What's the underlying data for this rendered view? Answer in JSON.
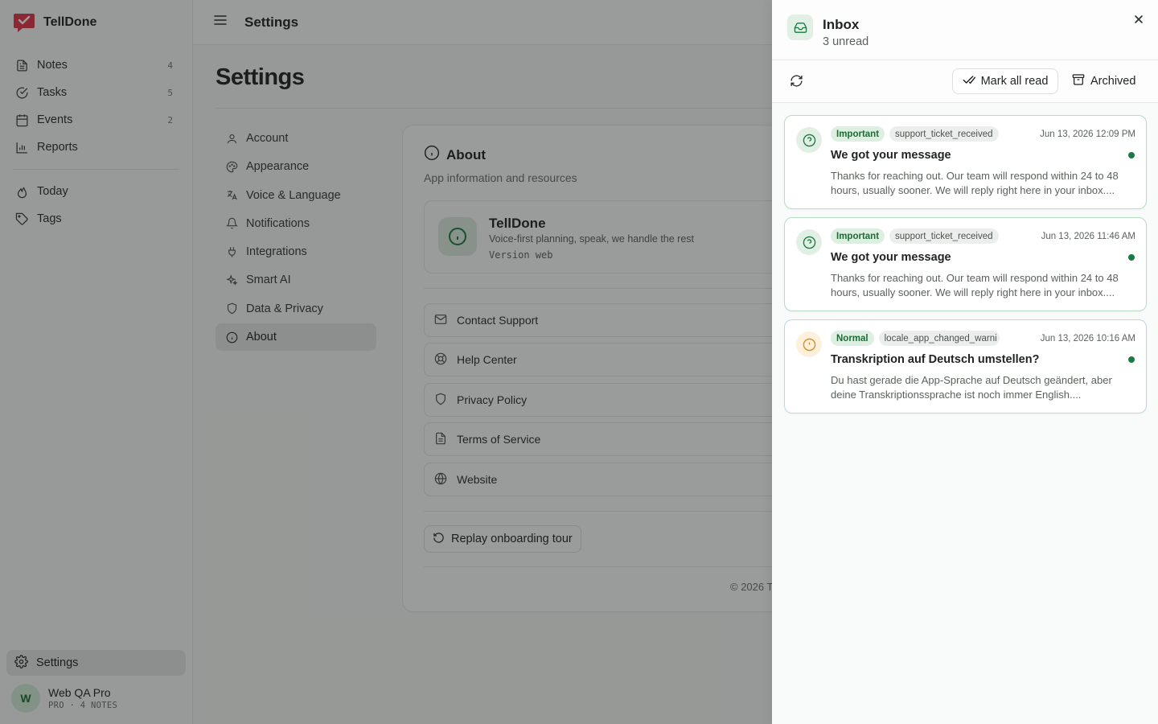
{
  "app": {
    "name": "TellDone"
  },
  "sidebar": {
    "items": [
      {
        "label": "Notes",
        "count": "4",
        "icon": "notes-icon"
      },
      {
        "label": "Tasks",
        "count": "5",
        "icon": "tasks-icon"
      },
      {
        "label": "Events",
        "count": "2",
        "icon": "calendar-icon"
      },
      {
        "label": "Reports",
        "count": "",
        "icon": "chart-icon"
      }
    ],
    "secondary": [
      {
        "label": "Today",
        "icon": "flame-icon"
      },
      {
        "label": "Tags",
        "icon": "tag-icon"
      }
    ],
    "settings_label": "Settings",
    "user": {
      "initial": "W",
      "name": "Web QA Pro",
      "meta": "PRO · 4 NOTES"
    }
  },
  "topbar": {
    "title": "Settings"
  },
  "page": {
    "title": "Settings"
  },
  "settings_nav": [
    {
      "label": "Account"
    },
    {
      "label": "Appearance"
    },
    {
      "label": "Voice & Language"
    },
    {
      "label": "Notifications"
    },
    {
      "label": "Integrations"
    },
    {
      "label": "Smart AI"
    },
    {
      "label": "Data & Privacy"
    },
    {
      "label": "About"
    }
  ],
  "about": {
    "title": "About",
    "subtitle": "App information and resources",
    "app_name": "TellDone",
    "app_desc": "Voice-first planning, speak, we handle the rest",
    "version": "Version web",
    "links": [
      {
        "label": "Contact Support"
      },
      {
        "label": "Help Center"
      },
      {
        "label": "Privacy Policy"
      },
      {
        "label": "Terms of Service"
      },
      {
        "label": "Website"
      }
    ],
    "replay_label": "Replay onboarding tour",
    "copyright": "© 2026 T"
  },
  "inbox": {
    "title": "Inbox",
    "subtitle": "3 unread",
    "mark_all_label": "Mark all read",
    "archived_label": "Archived",
    "messages": [
      {
        "priority": "Important",
        "tag": "support_ticket_received",
        "date": "Jun 13, 2026 12:09 PM",
        "title": "We got your message",
        "body": "Thanks for reaching out. Our team will respond within 24 to 48 hours, usually sooner. We will reply right here in your inbox....",
        "unread": true
      },
      {
        "priority": "Important",
        "tag": "support_ticket_received",
        "date": "Jun 13, 2026 11:46 AM",
        "title": "We got your message",
        "body": "Thanks for reaching out. Our team will respond within 24 to 48 hours, usually sooner. We will reply right here in your inbox....",
        "unread": true
      },
      {
        "priority": "Normal",
        "tag": "locale_app_changed_warni",
        "date": "Jun 13, 2026 10:16 AM",
        "title": "Transkription auf Deutsch umstellen?",
        "body": "Du hast gerade die App-Sprache auf Deutsch geändert, aber deine Transkriptionssprache ist noch immer English....",
        "unread": true
      }
    ]
  },
  "colors": {
    "accent": "#1b7a44",
    "brand_red": "#e0364a"
  }
}
